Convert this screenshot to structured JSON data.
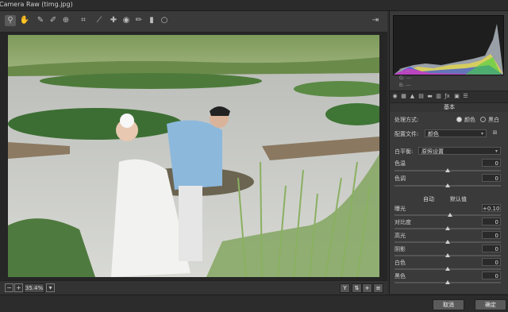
{
  "window": {
    "title": "Camera Raw (timg.jpg)"
  },
  "tools": [
    "zoom-tool",
    "hand-tool",
    "white-balance-tool",
    "color-sampler-tool",
    "targeted-adjustment-tool",
    "crop-tool",
    "straighten-tool",
    "spot-removal-tool",
    "red-eye-tool",
    "adjustment-brush-tool",
    "graduated-filter-tool",
    "radial-filter-tool"
  ],
  "statusbar": {
    "zoom": "35.4%"
  },
  "histogram": {
    "r": "R:",
    "g": "G:",
    "b": "B:",
    "r_val": "---",
    "g_val": "---",
    "b_val": "---"
  },
  "panel": {
    "section_title": "基本",
    "treatment_label": "处理方式:",
    "treatment_color": "颜色",
    "treatment_bw": "黑白",
    "profile_label": "配置文件:",
    "profile_value": "颜色",
    "wb_label": "白平衡:",
    "wb_value": "原照设置",
    "temp_label": "色温",
    "temp_value": "0",
    "tint_label": "色调",
    "tint_value": "0",
    "auto_label": "自动",
    "default_label": "默认值",
    "sliders": [
      {
        "label": "曝光",
        "value": "+0.10",
        "level": 0.52
      },
      {
        "label": "对比度",
        "value": "0",
        "level": 0.5
      },
      {
        "label": "高光",
        "value": "0",
        "level": 0.5
      },
      {
        "label": "阴影",
        "value": "0",
        "level": 0.5
      },
      {
        "label": "白色",
        "value": "0",
        "level": 0.5
      },
      {
        "label": "黑色",
        "value": "0",
        "level": 0.5
      }
    ]
  },
  "buttons": {
    "cancel": "取消",
    "ok": "确定"
  }
}
